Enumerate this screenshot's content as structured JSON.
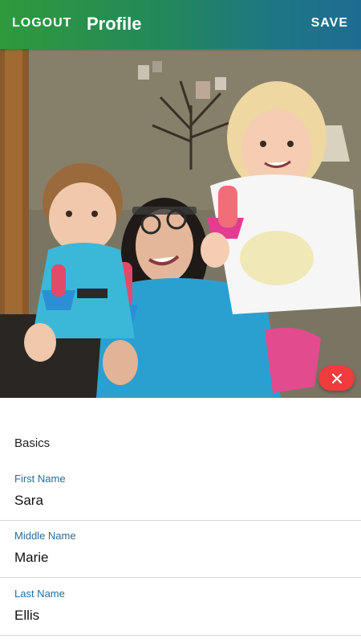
{
  "app_bar": {
    "logout_label": "LOGOUT",
    "title": "Profile",
    "save_label": "SAVE"
  },
  "photo": {
    "subject": "profile-photo-family-with-popsicles",
    "remove_icon": "close-icon"
  },
  "form": {
    "section_heading": "Basics",
    "fields": [
      {
        "label": "First Name",
        "value": "Sara"
      },
      {
        "label": "Middle Name",
        "value": "Marie"
      },
      {
        "label": "Last Name",
        "value": "Ellis"
      }
    ]
  },
  "colors": {
    "app_bar_gradient_start": "#2f9a3c",
    "app_bar_gradient_end": "#1f6c93",
    "field_label": "#2a6b99",
    "remove_button": "#f03c3c"
  }
}
